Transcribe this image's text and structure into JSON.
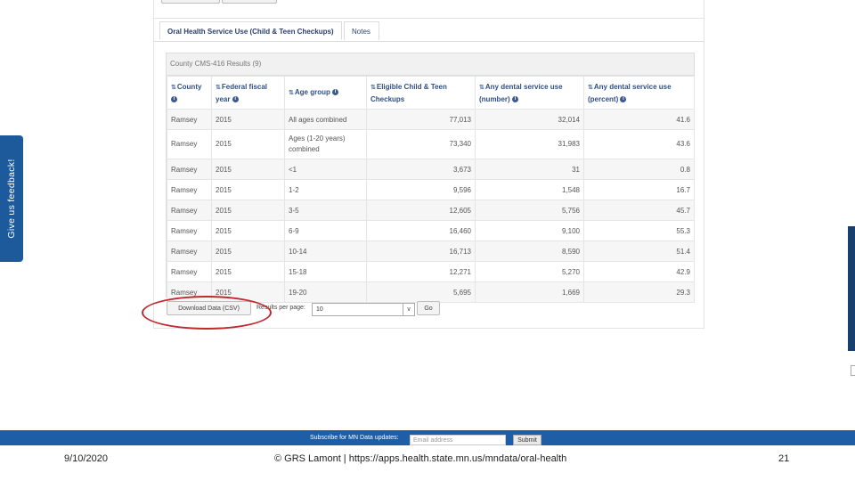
{
  "feedback": {
    "label": "Give us feedback!"
  },
  "tabs": [
    {
      "label": "Oral Health Service Use (Child & Teen Checkups)",
      "active": true
    },
    {
      "label": "Notes",
      "active": false
    }
  ],
  "results": {
    "heading": "County CMS-416 Results (9)",
    "columns": [
      {
        "label": "County",
        "info": true
      },
      {
        "label": "Federal fiscal year",
        "info": true
      },
      {
        "label": "Age group",
        "info": true
      },
      {
        "label": "Eligible Child & Teen Checkups",
        "info": false
      },
      {
        "label": "Any dental service use (number)",
        "info": true
      },
      {
        "label": "Any dental service use (percent)",
        "info": true
      }
    ],
    "rows": [
      [
        "Ramsey",
        "2015",
        "All ages combined",
        "77,013",
        "32,014",
        "41.6"
      ],
      [
        "Ramsey",
        "2015",
        "Ages (1-20 years) combined",
        "73,340",
        "31,983",
        "43.6"
      ],
      [
        "Ramsey",
        "2015",
        "<1",
        "3,673",
        "31",
        "0.8"
      ],
      [
        "Ramsey",
        "2015",
        "1-2",
        "9,596",
        "1,548",
        "16.7"
      ],
      [
        "Ramsey",
        "2015",
        "3-5",
        "12,605",
        "5,756",
        "45.7"
      ],
      [
        "Ramsey",
        "2015",
        "6-9",
        "16,460",
        "9,100",
        "55.3"
      ],
      [
        "Ramsey",
        "2015",
        "10-14",
        "16,713",
        "8,590",
        "51.4"
      ],
      [
        "Ramsey",
        "2015",
        "15-18",
        "12,271",
        "5,270",
        "42.9"
      ],
      [
        "Ramsey",
        "2015",
        "19-20",
        "5,695",
        "1,669",
        "29.3"
      ]
    ]
  },
  "controls": {
    "download_label": "Download Data (CSV)",
    "results_per_page_label": "Results per page:",
    "results_per_page_value": "10",
    "go_label": "Go"
  },
  "subscribe": {
    "label": "Subscribe for MN Data updates:",
    "email_placeholder": "Email address",
    "submit_label": "Submit"
  },
  "footer": {
    "date": "9/10/2020",
    "center": "© GRS Lamont  |  https://apps.health.state.mn.us/mndata/oral-health",
    "page": "21"
  },
  "colors": {
    "feedback_bg": "#1c5a9c",
    "footer_band": "#1e5ea6",
    "highlight_circle": "#c0282b",
    "header_text": "#2f4f86"
  },
  "icons": {
    "sort": "sort-arrows-icon",
    "info": "info-circle-icon",
    "select_caret": "chevron-down-icon"
  }
}
